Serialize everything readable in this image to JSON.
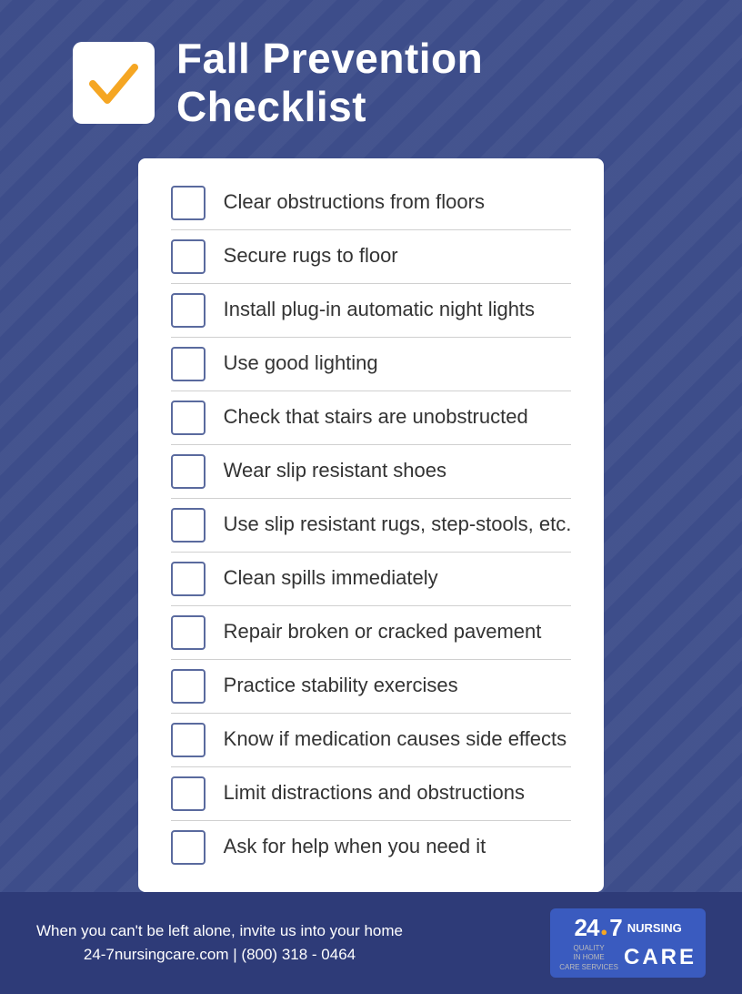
{
  "header": {
    "title_line1": "Fall Prevention",
    "title_line2": "Checklist"
  },
  "checklist": {
    "items": [
      {
        "id": 1,
        "label": "Clear obstructions from floors"
      },
      {
        "id": 2,
        "label": "Secure rugs to floor"
      },
      {
        "id": 3,
        "label": "Install plug-in automatic night lights"
      },
      {
        "id": 4,
        "label": "Use good lighting"
      },
      {
        "id": 5,
        "label": "Check that stairs are unobstructed"
      },
      {
        "id": 6,
        "label": "Wear slip resistant shoes"
      },
      {
        "id": 7,
        "label": "Use slip resistant rugs, step-stools, etc."
      },
      {
        "id": 8,
        "label": "Clean spills immediately"
      },
      {
        "id": 9,
        "label": "Repair broken or cracked pavement"
      },
      {
        "id": 10,
        "label": "Practice stability exercises"
      },
      {
        "id": 11,
        "label": "Know if medication causes side effects"
      },
      {
        "id": 12,
        "label": "Limit distractions and obstructions"
      },
      {
        "id": 13,
        "label": "Ask for help when you need it"
      }
    ]
  },
  "footer": {
    "line1": "When you can't be left alone, invite us into your home",
    "line2": "24-7nursingcare.com | (800) 318 - 0464",
    "logo_247": "24 7",
    "logo_nursing": "NURSING",
    "logo_care": "CARE",
    "logo_quality": "QUALITY\nIN HOME\nCARE SERVICES"
  }
}
